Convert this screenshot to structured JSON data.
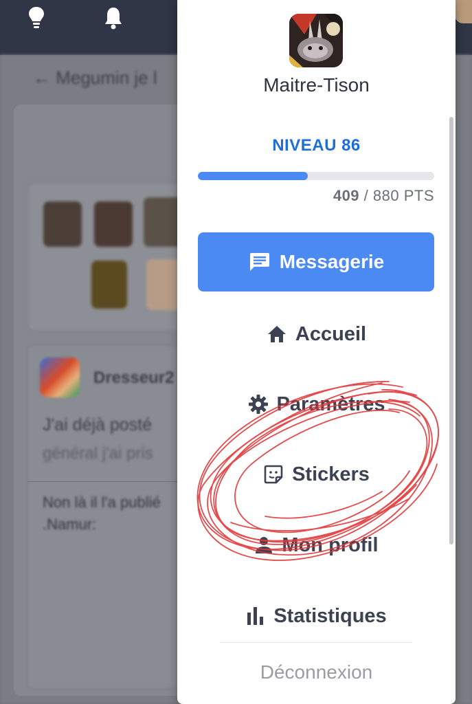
{
  "background": {
    "breadcrumb": "←  Megumin je l",
    "post": {
      "author": "Dresseur2",
      "line1": "J'ai déjà posté",
      "line2": "général j'ai pris",
      "line3": "Non là il l'a publié",
      "line4": ".Namur:"
    }
  },
  "topbar": {
    "icons": [
      "lightbulb-icon",
      "bell-icon"
    ]
  },
  "user_menu": {
    "username": "Maitre-Tison",
    "level_label": "NIVEAU 86",
    "points_current": "409",
    "points_separator": " / ",
    "points_total": "880 PTS",
    "progress_fraction": 0.465,
    "messaging_label": "Messagerie",
    "items": [
      {
        "label": "Accueil",
        "icon": "home-icon"
      },
      {
        "label": "Paramètres",
        "icon": "gear-icon"
      },
      {
        "label": "Stickers",
        "icon": "sticker-icon"
      },
      {
        "label": "Mon profil",
        "icon": "person-icon"
      },
      {
        "label": "Statistiques",
        "icon": "bar-chart-icon"
      }
    ],
    "logout_label": "Déconnexion"
  },
  "colors": {
    "accent": "#4a8af2",
    "level_text": "#1e6ed6",
    "annotation": "#e0383a",
    "topbar": "#2f3645"
  }
}
